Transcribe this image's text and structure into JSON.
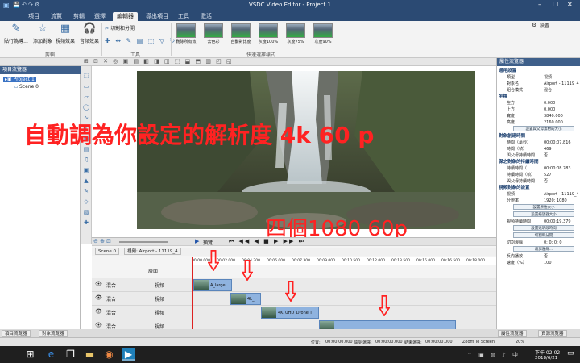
{
  "window": {
    "title": "VSDC Video Editor - Project 1",
    "settings_label": "設置"
  },
  "menus": [
    "項目",
    "流覽",
    "剪輯",
    "選擇",
    "編輯器",
    "導出項目",
    "工具",
    "激活"
  ],
  "active_menu_index": 4,
  "ribbon": {
    "buttons": [
      {
        "label": "貼行為導...",
        "icon": "wand-icon"
      },
      {
        "label": "添加對象",
        "icon": "star-icon"
      },
      {
        "label": "視頻效果",
        "icon": "film-icon"
      },
      {
        "label": "音頻效果",
        "icon": "headphones-icon"
      }
    ],
    "group1": "剪輯",
    "cut_split": "切割和分開",
    "group2": "工具",
    "effects": [
      "刪除所有效",
      "去色彩",
      "自動對比度",
      "灰度100%",
      "灰度75%",
      "灰度90%"
    ],
    "group3": "快速選擇樣式"
  },
  "left_panel": {
    "header": "項目流覽器",
    "items": [
      "Project 1",
      "Scene 0"
    ]
  },
  "right_panel": {
    "header": "屬性流覽器",
    "sections": [
      {
        "title": "通用設置",
        "rows": [
          [
            "類型",
            "視頻"
          ],
          [
            "對象名",
            "Airport - 11119_4"
          ],
          [
            "組合模式",
            "混合"
          ]
        ]
      },
      {
        "title": "坐標",
        "rows": [
          [
            "左方",
            "0.000"
          ],
          [
            "上方",
            "0.000"
          ],
          [
            "寬度",
            "3840.000"
          ],
          [
            "高度",
            "2160.000"
          ]
        ]
      },
      {
        "button": "設置與父母素材的大小"
      },
      {
        "title": "對象創建時間",
        "rows": [
          [
            "時間（毫秒）",
            "00:00:07.816"
          ],
          [
            "時間（幀）",
            "469"
          ],
          [
            "與父母持續時間",
            "否"
          ]
        ]
      },
      {
        "title": "保之對象的持續時間",
        "rows": [
          [
            "持續時間（",
            "00:00:08.783"
          ],
          [
            "持續時間（幀）",
            "527"
          ],
          [
            "與父母持續時間",
            "否"
          ]
        ]
      },
      {
        "title": "視頻對象的設置",
        "rows": [
          [
            "視頻",
            "Airport - 11119_4"
          ],
          [
            "分辨率",
            "1920; 1080"
          ]
        ]
      },
      {
        "button": "設置原始大小"
      },
      {
        "button": "設置播放器大小"
      },
      {
        "rows": [
          [
            "視頻持續時間",
            "00:00:19.379"
          ]
        ]
      },
      {
        "button": "設置透明段時間"
      },
      {
        "button": "切割和分開"
      },
      {
        "rows": [
          [
            "切割邊緣",
            "0; 0; 0; 0"
          ]
        ]
      },
      {
        "button": "裁剪邊緣..."
      },
      {
        "rows": [
          [
            "反向播放",
            "否"
          ],
          [
            "速度（%）",
            "100"
          ]
        ]
      }
    ]
  },
  "timeline": {
    "tabs": [
      "Scene 0",
      "視頻: Airport - 11119_4"
    ],
    "preview_label": "預覽",
    "times": [
      "00:00.000",
      "00:02.000",
      "00:04.300",
      "00:06.000",
      "00:07.300",
      "00:09.000",
      "00:10.500",
      "00:12.000",
      "00:13.500",
      "00:15.000",
      "00:16.500",
      "00:18.000"
    ],
    "layer_header": "層面",
    "tracks": [
      {
        "blend": "混合",
        "type": "視頻",
        "clip": "A_large"
      },
      {
        "blend": "混合",
        "type": "視頻",
        "clip": "4k_l"
      },
      {
        "blend": "混合",
        "type": "視頻",
        "clip": "4K_UHD_Drone_l"
      },
      {
        "blend": "混合",
        "type": "視頻",
        "clip": ""
      }
    ]
  },
  "bottom_tabs": [
    "項目流覽器",
    "對象流覽器",
    "屬性流覽器",
    "資源流覽器"
  ],
  "status": {
    "position": "位置:",
    "position_val": "00:00:00.000",
    "start_sel": "開始選擇:",
    "start_val": "00:00:00.000",
    "end_sel": "結束選擇:",
    "end_val": "00:00:00.000",
    "zoom": "Zoom To Screen",
    "percent": "20%"
  },
  "overlays": {
    "main_text": "自動調為你設定的解析度 4k 60 p",
    "sub_text": "四個1080 60p"
  },
  "taskbar": {
    "time": "下午 02:02",
    "date": "2018/6/21"
  }
}
